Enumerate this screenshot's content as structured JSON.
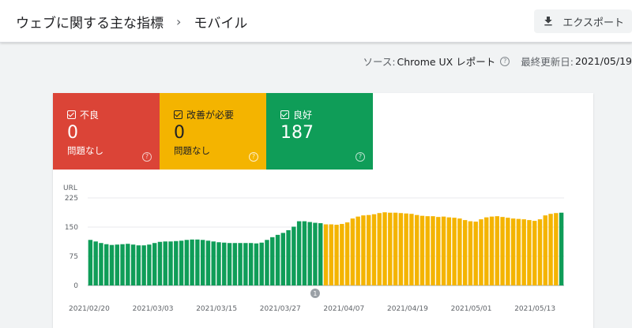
{
  "header": {
    "breadcrumb_parent": "ウェブに関する主な指標",
    "breadcrumb_sep": "›",
    "breadcrumb_current": "モバイル",
    "export_label": "エクスポート",
    "export_icon": "download-icon"
  },
  "subbar": {
    "source_label": "ソース:",
    "source_value": "Chrome UX レポート",
    "help_glyph": "?",
    "updated_label": "最終更新日:",
    "updated_value": "2021/05/19"
  },
  "tiles": [
    {
      "label": "不良",
      "count": "0",
      "sub": "問題なし",
      "color": "#db4437"
    },
    {
      "label": "改善が必要",
      "count": "0",
      "sub": "問題なし",
      "color": "#f4b400"
    },
    {
      "label": "良好",
      "count": "187",
      "sub": "",
      "color": "#0f9d58"
    }
  ],
  "chart_data": {
    "type": "bar",
    "ylabel": "URL",
    "ylim": [
      0,
      225
    ],
    "yticks": [
      0,
      75,
      150,
      225
    ],
    "x_tick_labels": [
      "2021/02/20",
      "2021/03/03",
      "2021/03/15",
      "2021/03/27",
      "2021/04/07",
      "2021/04/19",
      "2021/05/01",
      "2021/05/13"
    ],
    "annotation": "1",
    "series": [
      {
        "name": "良好",
        "color": "#0f9d58",
        "values": [
          117,
          113,
          109,
          106,
          104,
          105,
          106,
          107,
          105,
          103,
          103,
          105,
          109,
          112,
          113,
          113,
          114,
          115,
          117,
          118,
          118,
          117,
          115,
          113,
          111,
          110,
          109,
          109,
          109,
          109,
          109,
          108,
          110,
          117,
          124,
          130,
          135,
          142,
          151,
          165,
          165,
          163,
          161,
          160,
          0,
          0,
          0,
          0,
          0,
          0,
          0,
          0,
          0,
          0,
          0,
          0,
          0,
          0,
          0,
          0,
          0,
          0,
          0,
          0,
          0,
          0,
          0,
          0,
          0,
          0,
          0,
          0,
          0,
          0,
          0,
          0,
          0,
          0,
          0,
          0,
          0,
          0,
          0,
          0,
          0,
          0,
          0,
          0,
          187
        ]
      },
      {
        "name": "改善が必要",
        "color": "#f4b400",
        "values": [
          0,
          0,
          0,
          0,
          0,
          0,
          0,
          0,
          0,
          0,
          0,
          0,
          0,
          0,
          0,
          0,
          0,
          0,
          0,
          0,
          0,
          0,
          0,
          0,
          0,
          0,
          0,
          0,
          0,
          0,
          0,
          0,
          0,
          0,
          0,
          0,
          0,
          0,
          0,
          0,
          0,
          0,
          0,
          0,
          157,
          157,
          156,
          158,
          162,
          172,
          177,
          180,
          181,
          183,
          186,
          188,
          187,
          187,
          186,
          185,
          184,
          181,
          179,
          178,
          178,
          176,
          177,
          175,
          174,
          172,
          168,
          165,
          164,
          170,
          175,
          177,
          178,
          176,
          174,
          172,
          171,
          170,
          168,
          166,
          170,
          180,
          184,
          186,
          0
        ]
      }
    ]
  }
}
